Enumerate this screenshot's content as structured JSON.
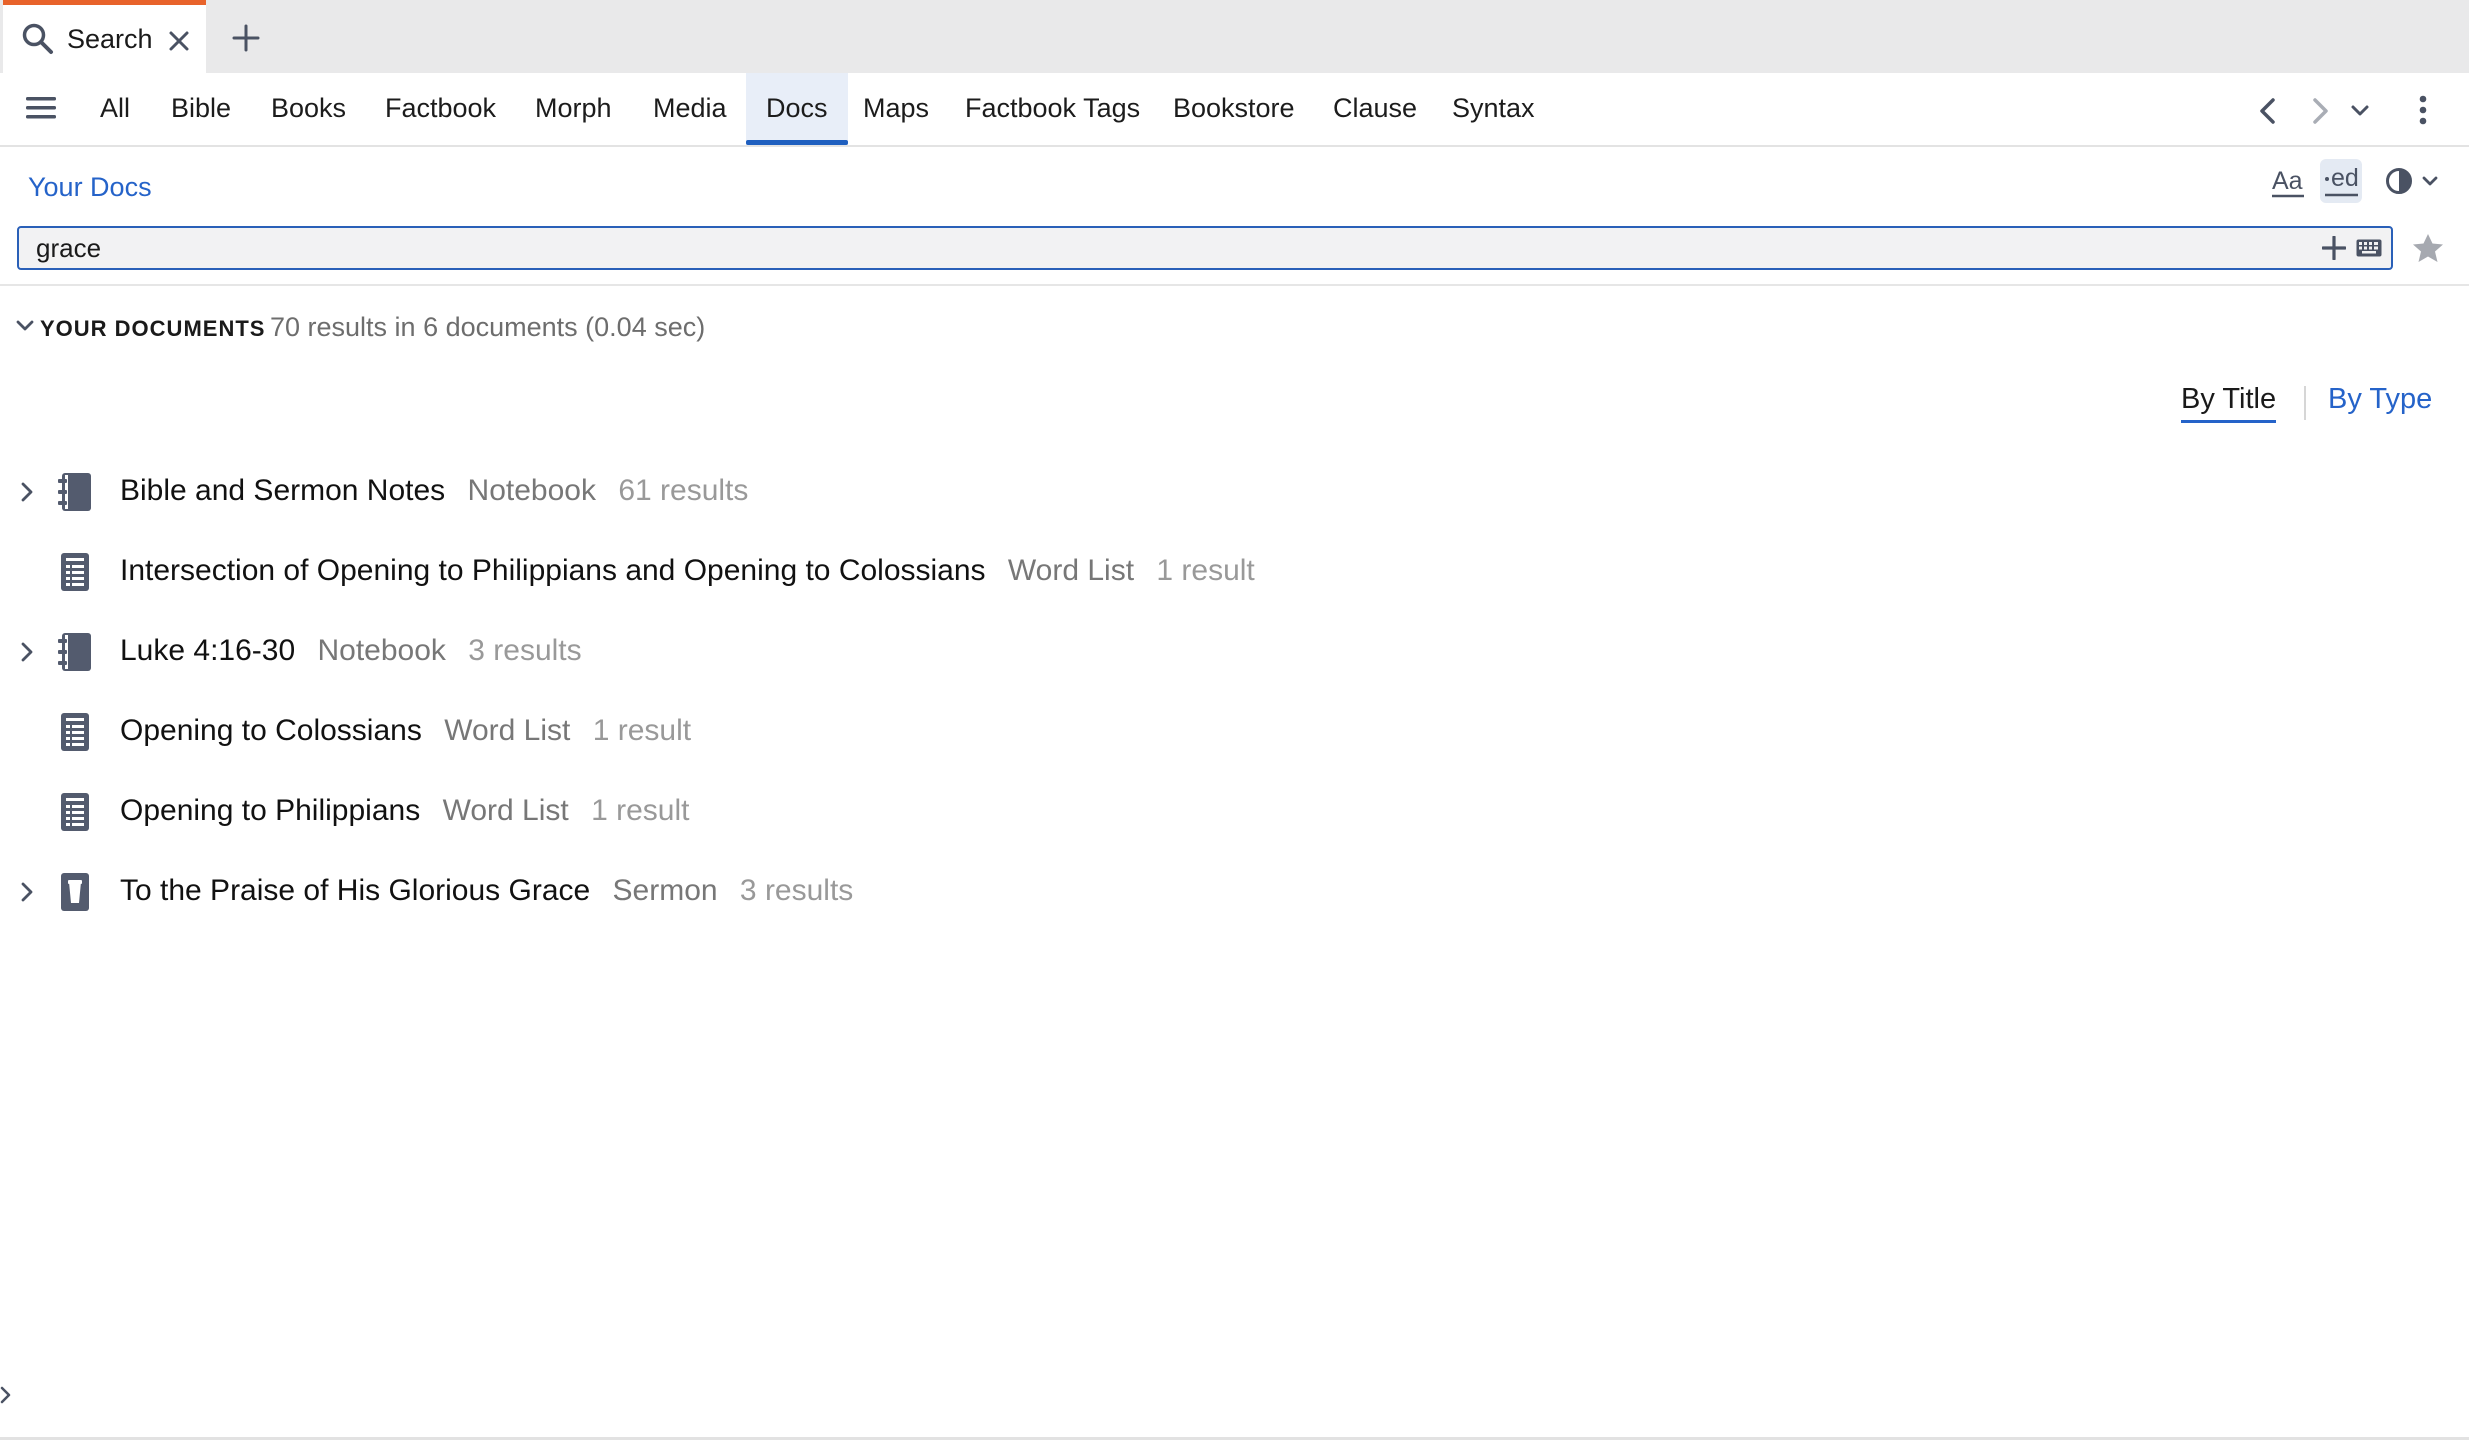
{
  "tab": {
    "label": "Search"
  },
  "nav": {
    "items": [
      {
        "label": "All"
      },
      {
        "label": "Bible"
      },
      {
        "label": "Books"
      },
      {
        "label": "Factbook"
      },
      {
        "label": "Morph"
      },
      {
        "label": "Media"
      },
      {
        "label": "Docs",
        "active": true
      },
      {
        "label": "Maps"
      },
      {
        "label": "Factbook Tags"
      },
      {
        "label": "Bookstore"
      },
      {
        "label": "Clause"
      },
      {
        "label": "Syntax"
      }
    ]
  },
  "scope": {
    "label": "Your Docs"
  },
  "toolbar": {
    "font_label": "Aa",
    "edit_label": "ed"
  },
  "search": {
    "value": "grace"
  },
  "section": {
    "title": "YOUR DOCUMENTS",
    "summary": "70 results in 6 documents (0.04 sec)"
  },
  "sort": {
    "by_title": "By Title",
    "by_type": "By Type",
    "selected": "By Title"
  },
  "results": [
    {
      "title": "Bible and Sermon Notes",
      "type": "Notebook",
      "count": "61 results",
      "icon": "notebook-icon",
      "expandable": true
    },
    {
      "title": "Intersection of Opening to Philippians and Opening to Colossians",
      "type": "Word List",
      "count": "1 result",
      "icon": "word-list-icon",
      "expandable": false
    },
    {
      "title": "Luke 4:16-30",
      "type": "Notebook",
      "count": "3 results",
      "icon": "notebook-icon",
      "expandable": true
    },
    {
      "title": "Opening to Colossians",
      "type": "Word List",
      "count": "1 result",
      "icon": "word-list-icon",
      "expandable": false
    },
    {
      "title": "Opening to Philippians",
      "type": "Word List",
      "count": "1 result",
      "icon": "word-list-icon",
      "expandable": false
    },
    {
      "title": "To the Praise of His Glorious Grace",
      "type": "Sermon",
      "count": "3 results",
      "icon": "sermon-icon",
      "expandable": true
    }
  ],
  "colors": {
    "accent": "#2563c9",
    "tab_accent": "#e8632b",
    "icon_gray": "#4f5669"
  }
}
